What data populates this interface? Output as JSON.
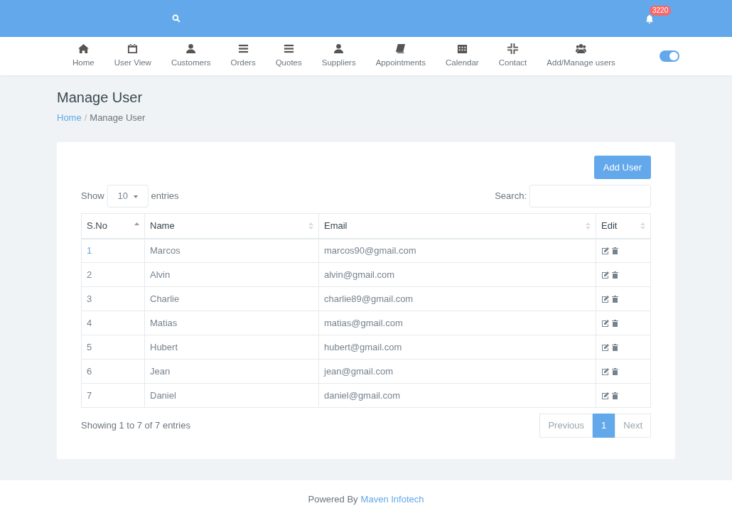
{
  "topbar": {
    "notification_count": "3220"
  },
  "nav": [
    {
      "label": "Home",
      "kind": "home"
    },
    {
      "label": "User View",
      "kind": "calendar"
    },
    {
      "label": "Customers",
      "kind": "user"
    },
    {
      "label": "Orders",
      "kind": "bars"
    },
    {
      "label": "Quotes",
      "kind": "bars"
    },
    {
      "label": "Suppliers",
      "kind": "user"
    },
    {
      "label": "Appointments",
      "kind": "book"
    },
    {
      "label": "Calendar",
      "kind": "grid"
    },
    {
      "label": "Contact",
      "kind": "compress"
    },
    {
      "label": "Add/Manage users",
      "kind": "users"
    }
  ],
  "theme_toggle": {
    "on": true
  },
  "page": {
    "title": "Manage User",
    "breadcrumb": [
      {
        "label": "Home",
        "link": true
      },
      {
        "label": "Manage User",
        "link": false
      }
    ],
    "separator": "/"
  },
  "add_button": "Add User",
  "length": {
    "before": "Show",
    "value": "10",
    "after": "entries"
  },
  "search": {
    "label": "Search:"
  },
  "table": {
    "columns": [
      {
        "label": "S.No",
        "sorted": true
      },
      {
        "label": "Name",
        "sorted": false
      },
      {
        "label": "Email",
        "sorted": false
      },
      {
        "label": "Edit",
        "sorted": false
      }
    ],
    "rows": [
      {
        "sno": "1",
        "name": "Marcos",
        "email": "marcos90@gmail.com",
        "selected": true
      },
      {
        "sno": "2",
        "name": "Alvin",
        "email": "alvin@gmail.com",
        "selected": false
      },
      {
        "sno": "3",
        "name": "Charlie",
        "email": "charlie89@gmail.com",
        "selected": false
      },
      {
        "sno": "4",
        "name": "Matias",
        "email": "matias@gmail.com",
        "selected": false
      },
      {
        "sno": "5",
        "name": "Hubert",
        "email": "hubert@gmail.com",
        "selected": false
      },
      {
        "sno": "6",
        "name": "Jean",
        "email": "jean@gmail.com",
        "selected": false
      },
      {
        "sno": "7",
        "name": "Daniel",
        "email": "daniel@gmail.com",
        "selected": false
      }
    ]
  },
  "info": "Showing 1 to 7 of 7 entries",
  "pagination": [
    {
      "label": "Previous",
      "selected": false,
      "disabled": true
    },
    {
      "label": "1",
      "selected": true,
      "disabled": false
    },
    {
      "label": "Next",
      "selected": false,
      "disabled": true
    }
  ],
  "footer": {
    "text": "Powered By",
    "link": "Maven Infotech"
  }
}
